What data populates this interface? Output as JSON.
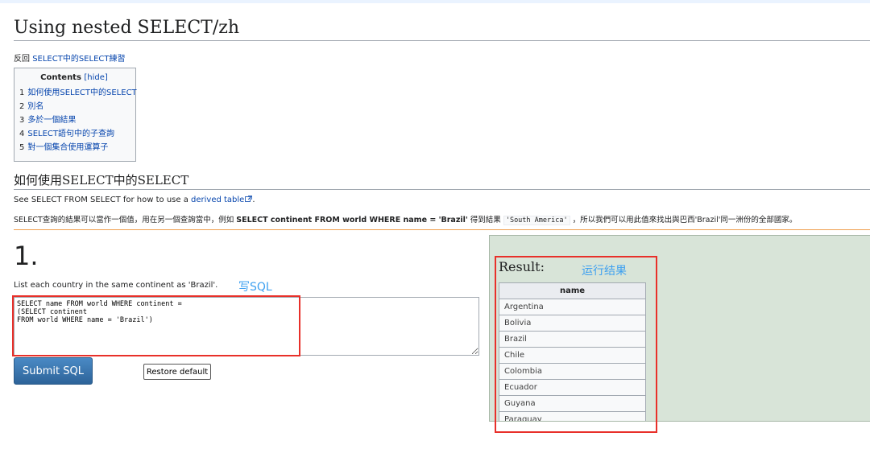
{
  "page": {
    "title": "Using nested SELECT/zh",
    "back_prefix": "反回 ",
    "back_link": "SELECT中的SELECT練習"
  },
  "toc": {
    "heading": "Contents",
    "hide_label": "[hide]",
    "items": [
      {
        "num": "1",
        "label": "如何使用SELECT中的SELECT"
      },
      {
        "num": "2",
        "label": "別名"
      },
      {
        "num": "3",
        "label": "多於一個結果"
      },
      {
        "num": "4",
        "label": "SELECT語句中的子查詢"
      },
      {
        "num": "5",
        "label": "對一個集合使用運算子"
      }
    ]
  },
  "section": {
    "heading": "如何使用SELECT中的SELECT",
    "p1_text": "See SELECT FROM SELECT for how to use a ",
    "p1_link": "derived table",
    "p1_end": ".",
    "p2_a": "SELECT查詢的結果可以當作一個值，用在另一個查詢當中，例如 ",
    "p2_bold": "SELECT continent FROM world WHERE name = 'Brazil'",
    "p2_b": " 得到結果 ",
    "p2_code": "'South America'",
    "p2_c": " ，所以我們可以用此值來找出與巴西'Brazil'同一洲份的全部國家。"
  },
  "question": {
    "number": "1.",
    "text": "List each country in the same continent as 'Brazil'.",
    "annotation_sql": "写SQL",
    "sql": "SELECT name FROM world WHERE continent =\n(SELECT continent\nFROM world WHERE name = 'Brazil')",
    "submit_label": "Submit SQL",
    "restore_label": "Restore default"
  },
  "result": {
    "title": "Result:",
    "annotation": "运行结果",
    "column": "name",
    "rows": [
      "Argentina",
      "Bolivia",
      "Brazil",
      "Chile",
      "Colombia",
      "Ecuador",
      "Guyana",
      "Paraguay"
    ]
  },
  "colors": {
    "link": "#0645ad",
    "annotation": "#3ea0f0",
    "highlight_box": "#e8302a",
    "result_panel": "#d8e4d8",
    "submit_button": "#2d6399"
  }
}
